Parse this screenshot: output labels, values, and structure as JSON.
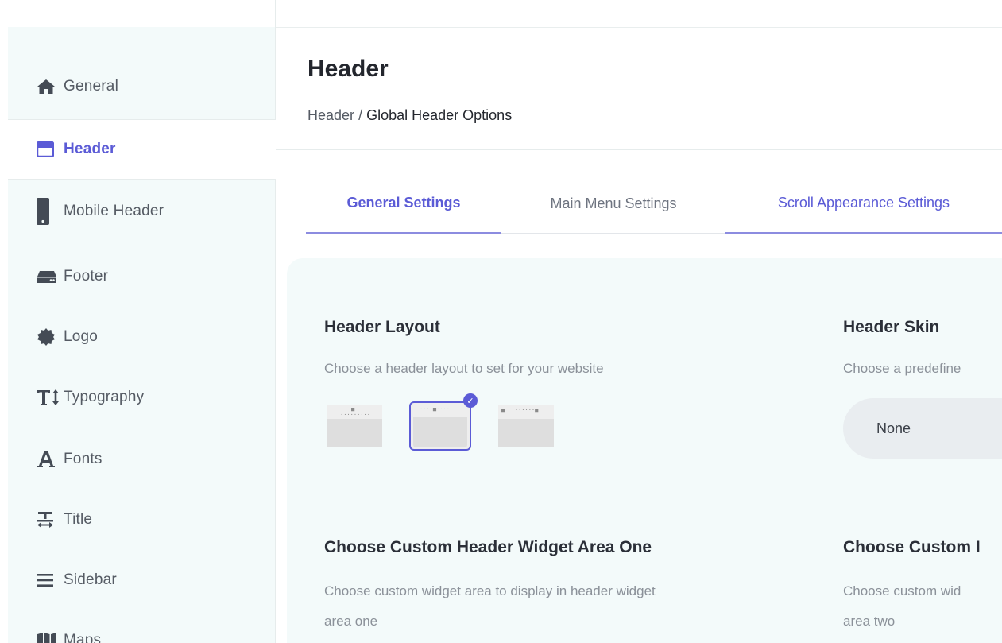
{
  "sidebar": {
    "items": [
      {
        "label": "General",
        "icon": "home-icon",
        "active": false
      },
      {
        "label": "Header",
        "icon": "header-window-icon",
        "active": true
      },
      {
        "label": "Mobile Header",
        "icon": "mobile-phone-icon",
        "active": false
      },
      {
        "label": "Footer",
        "icon": "footer-drive-icon",
        "active": false
      },
      {
        "label": "Logo",
        "icon": "badge-seal-icon",
        "active": false
      },
      {
        "label": "Typography",
        "icon": "text-height-icon",
        "active": false
      },
      {
        "label": "Fonts",
        "icon": "font-letter-icon",
        "active": false
      },
      {
        "label": "Title",
        "icon": "text-align-title-icon",
        "active": false
      },
      {
        "label": "Sidebar",
        "icon": "hamburger-lines-icon",
        "active": false
      },
      {
        "label": "Maps",
        "icon": "map-icon",
        "active": false
      }
    ]
  },
  "main": {
    "title": "Header",
    "breadcrumb": {
      "parent": "Header",
      "separator": "/",
      "current": "Global Header Options"
    },
    "tabs": [
      {
        "label": "General Settings",
        "active": true
      },
      {
        "label": "Main Menu Settings",
        "active": false
      },
      {
        "label": "Scroll Appearance Settings",
        "active": false
      }
    ],
    "header_layout": {
      "title": "Header Layout",
      "description": "Choose a header layout to set for your website",
      "selected_index": 1
    },
    "header_skin": {
      "title": "Header Skin",
      "description": "Choose a predefine",
      "selected": "None"
    },
    "widget_area_one": {
      "title": "Choose Custom Header Widget Area One",
      "description_line1": "Choose custom widget area to display in header widget",
      "description_line2": "area one"
    },
    "widget_area_two": {
      "title": "Choose Custom I",
      "description_line1": "Choose custom wid",
      "description_line2": "area two"
    }
  },
  "colors": {
    "accent": "#5b5bd6",
    "sidebar_bg": "#f3fafa",
    "panel_bg": "#f3fafa",
    "muted_text": "#8b9199"
  }
}
